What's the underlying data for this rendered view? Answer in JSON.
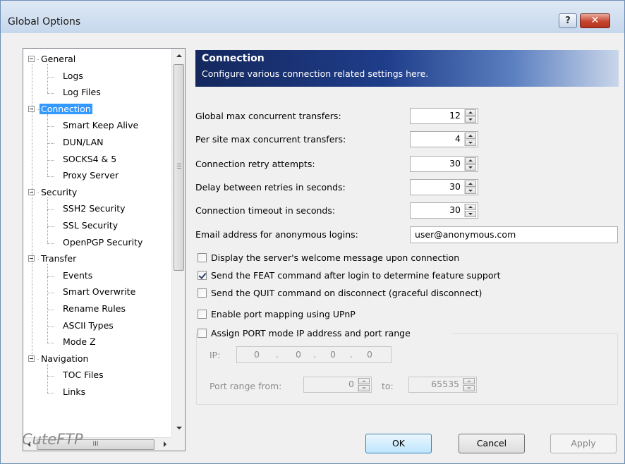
{
  "window": {
    "title": "Global Options",
    "help_label": "?",
    "close_label": "✕"
  },
  "tree": {
    "items": [
      {
        "label": "General",
        "level": 0,
        "expanded": true
      },
      {
        "label": "Logs",
        "level": 1
      },
      {
        "label": "Log Files",
        "level": 1
      },
      {
        "label": "Connection",
        "level": 0,
        "expanded": true,
        "selected": true
      },
      {
        "label": "Smart Keep Alive",
        "level": 1
      },
      {
        "label": "DUN/LAN",
        "level": 1
      },
      {
        "label": "SOCKS4 & 5",
        "level": 1
      },
      {
        "label": "Proxy Server",
        "level": 1
      },
      {
        "label": "Security",
        "level": 0,
        "expanded": true
      },
      {
        "label": "SSH2 Security",
        "level": 1
      },
      {
        "label": "SSL Security",
        "level": 1
      },
      {
        "label": "OpenPGP Security",
        "level": 1
      },
      {
        "label": "Transfer",
        "level": 0,
        "expanded": true
      },
      {
        "label": "Events",
        "level": 1
      },
      {
        "label": "Smart Overwrite",
        "level": 1
      },
      {
        "label": "Rename Rules",
        "level": 1
      },
      {
        "label": "ASCII Types",
        "level": 1
      },
      {
        "label": "Mode Z",
        "level": 1
      },
      {
        "label": "Navigation",
        "level": 0,
        "expanded": true
      },
      {
        "label": "TOC Files",
        "level": 1
      },
      {
        "label": "Links",
        "level": 1
      }
    ],
    "hscroll_grip": "III"
  },
  "header": {
    "title": "Connection",
    "subtitle": "Configure various connection related settings here."
  },
  "form": {
    "global_max_label": "Global max concurrent transfers:",
    "global_max_value": "12",
    "per_site_label": "Per site max concurrent transfers:",
    "per_site_value": "4",
    "retry_label": "Connection retry attempts:",
    "retry_value": "30",
    "delay_label": "Delay between retries in seconds:",
    "delay_value": "30",
    "timeout_label": "Connection timeout in seconds:",
    "timeout_value": "30",
    "email_label": "Email address for anonymous logins:",
    "email_value": "user@anonymous.com"
  },
  "checks": {
    "welcome": {
      "label": "Display the server's welcome message upon connection",
      "checked": false
    },
    "feat": {
      "label": "Send the FEAT command after login to determine feature support",
      "checked": true
    },
    "quit": {
      "label": "Send the QUIT command on disconnect (graceful disconnect)",
      "checked": false
    },
    "upnp": {
      "label": "Enable port mapping using UPnP",
      "checked": false
    },
    "port_mode": {
      "label": "Assign PORT mode IP address and port range",
      "checked": false
    }
  },
  "port_group": {
    "ip_label": "IP:",
    "ip_octets": [
      "0",
      "0",
      "0",
      "0"
    ],
    "ip_dot": ".",
    "range_from_label": "Port range from:",
    "range_from_value": "0",
    "range_to_label": "to:",
    "range_to_value": "65535"
  },
  "footer": {
    "brand": "CuteFTP",
    "ok_label": "OK",
    "cancel_label": "Cancel",
    "apply_label": "Apply"
  }
}
